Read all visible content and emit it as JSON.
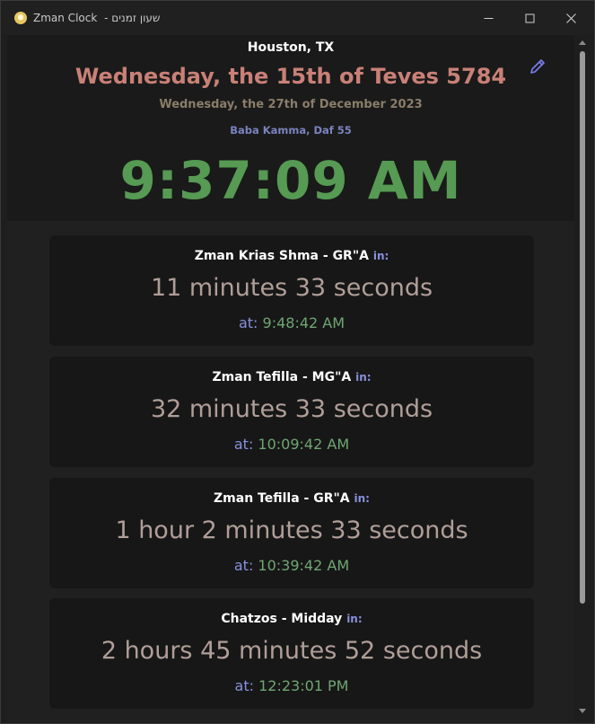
{
  "window": {
    "title": "Zman Clock",
    "title_hebrew": "- שעון זמנים",
    "controls": {
      "minimize_icon": "minimize-icon",
      "maximize_icon": "maximize-icon",
      "close_icon": "close-icon"
    }
  },
  "header": {
    "location": "Houston, TX",
    "hebrew_date": "Wednesday, the 15th of Teves 5784",
    "gregorian_date": "Wednesday, the 27th of December 2023",
    "daf_yomi": "Baba Kamma, Daf 55",
    "current_time": "9:37:09 AM",
    "edit_icon": "pencil-icon"
  },
  "zmanim": [
    {
      "name": "Zman Krias Shma - GR\"A",
      "in_label": "in:",
      "countdown": "11 minutes 33 seconds",
      "at_label": "at:",
      "time": "9:48:42 AM"
    },
    {
      "name": "Zman Tefilla - MG\"A",
      "in_label": "in:",
      "countdown": "32 minutes 33 seconds",
      "at_label": "at:",
      "time": "10:09:42 AM"
    },
    {
      "name": "Zman Tefilla - GR\"A",
      "in_label": "in:",
      "countdown": "1 hour 2 minutes 33 seconds",
      "at_label": "at:",
      "time": "10:39:42 AM"
    },
    {
      "name": "Chatzos - Midday",
      "in_label": "in:",
      "countdown": "2 hours 45 minutes 52 seconds",
      "at_label": "at:",
      "time": "12:23:01 PM"
    }
  ],
  "colors": {
    "hebrew_date": "#c98077",
    "gregorian_date": "#8a7d69",
    "daf_yomi": "#7a83be",
    "clock": "#569a53",
    "label_accent": "#8890dd",
    "time_green": "#6fa672",
    "countdown": "#b09e98"
  }
}
